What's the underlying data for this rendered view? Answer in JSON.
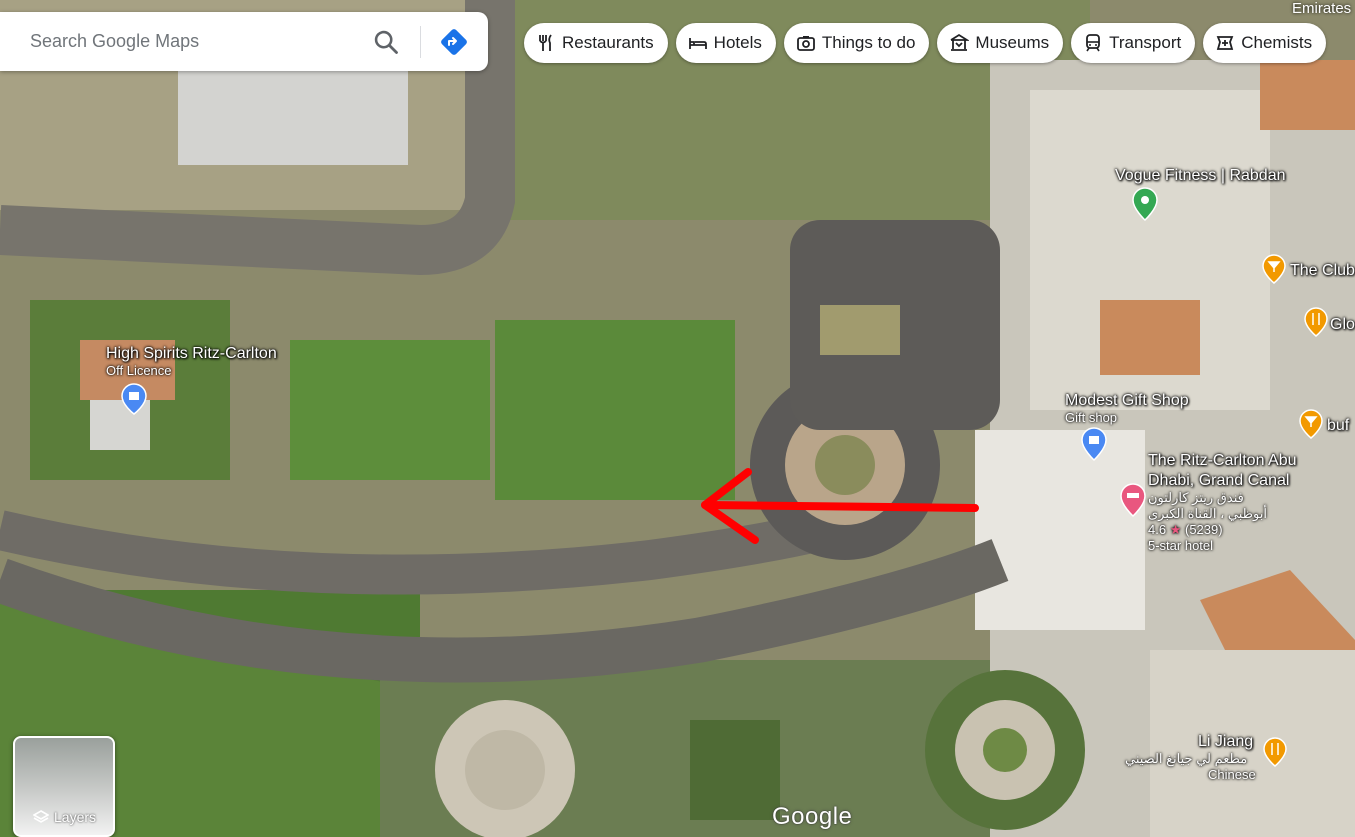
{
  "search": {
    "placeholder": "Search Google Maps"
  },
  "chips": [
    {
      "label": "Restaurants",
      "icon": "restaurant-icon"
    },
    {
      "label": "Hotels",
      "icon": "bed-icon"
    },
    {
      "label": "Things to do",
      "icon": "camera-icon"
    },
    {
      "label": "Museums",
      "icon": "museum-icon"
    },
    {
      "label": "Transport",
      "icon": "train-icon"
    },
    {
      "label": "Chemists",
      "icon": "pharmacy-icon"
    }
  ],
  "map": {
    "region_label": "Emirates",
    "pois": {
      "high_spirits": {
        "name": "High Spirits Ritz-Carlton",
        "category": "Off Licence"
      },
      "vogue_fitness": {
        "name": "Vogue Fitness | Rabdan"
      },
      "the_club": {
        "name": "The Club"
      },
      "glo": {
        "name": "Glo"
      },
      "buf": {
        "name": "buf"
      },
      "modest_gift": {
        "name": "Modest Gift Shop",
        "category": "Gift shop"
      },
      "ritz_carlton": {
        "name_line1": "The Ritz-Carlton Abu",
        "name_line2": "Dhabi, Grand Canal",
        "arabic_line1": "فندق ريتز كارلتون",
        "arabic_line2": "أبوظبي ، القناة الكبرى",
        "rating": "4.6",
        "reviews": "(5239)",
        "category": "5-star hotel"
      },
      "li_jiang": {
        "name": "Li Jiang",
        "arabic": "مطعم لي جيانغ الصيني",
        "category": "Chinese"
      }
    },
    "annotation": {
      "color": "#ff0000"
    },
    "colors": {
      "pin_blue": "#4a89f3",
      "pin_green": "#34a853",
      "pin_orange": "#f29900",
      "pin_pink": "#e9577f"
    }
  },
  "layers": {
    "label": "Layers"
  },
  "brand": {
    "logo_text": "Google"
  }
}
